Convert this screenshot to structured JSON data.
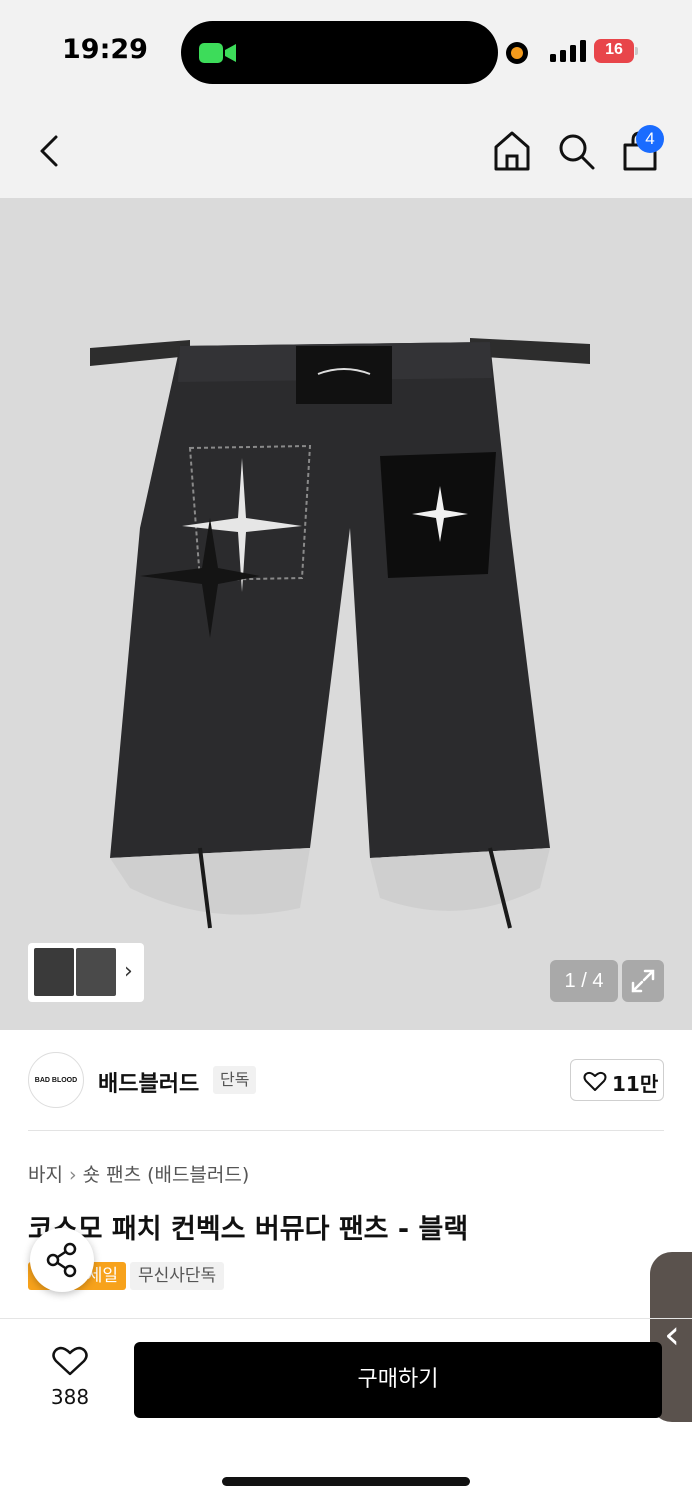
{
  "status": {
    "time": "19:29",
    "battery": "16"
  },
  "nav": {
    "cart_count": "4",
    "icons": [
      "back-icon",
      "home-icon",
      "search-icon",
      "shopping-bag-icon"
    ]
  },
  "gallery": {
    "counter": "1 / 4",
    "thumb_chevron": "›"
  },
  "brand": {
    "logo_text": "BAD BLOOD",
    "name": "배드블러드",
    "tag": "단독",
    "likes": "11만"
  },
  "product": {
    "breadcrumb": [
      "바지",
      "숏 팬츠",
      "(배드블러드)"
    ],
    "breadcrumb_sep": "›",
    "title": "코스모 패치 컨벡스 버뮤다 팬츠 - 블랙",
    "badge_sale": "세일",
    "badge_exclusive": "무신사단독"
  },
  "bottom": {
    "wish_count": "388",
    "buy_label": "구매하기",
    "side_chevron": "‹"
  },
  "colors": {
    "accent_badge": "#f7a21b",
    "cart_badge": "#1a6cff",
    "buy_button": "#000000",
    "battery": "#e8454a"
  }
}
